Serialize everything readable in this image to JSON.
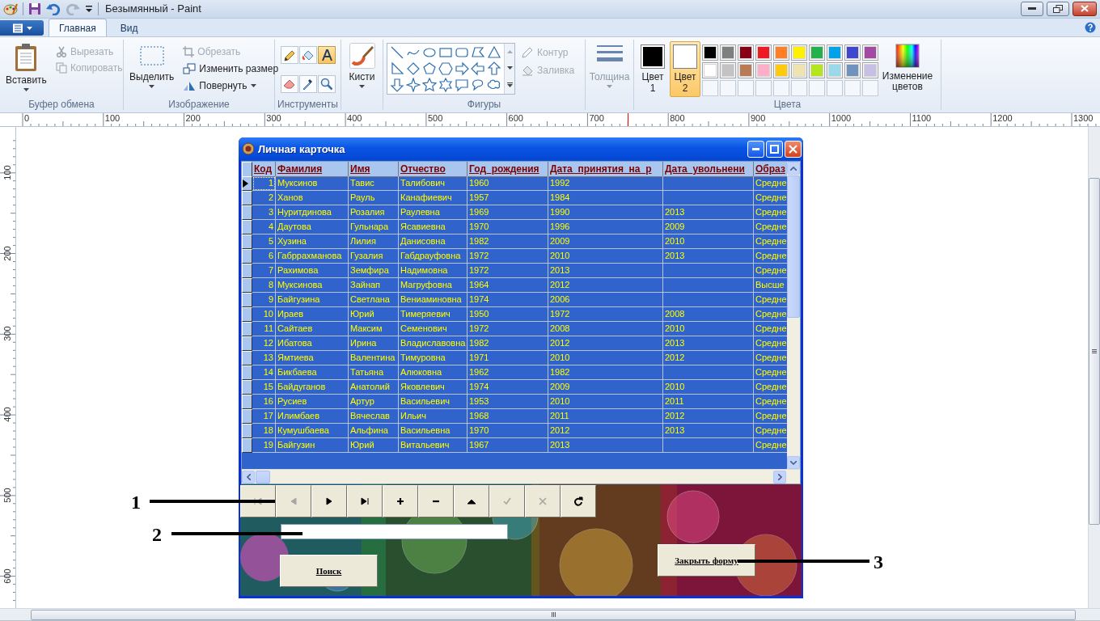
{
  "window": {
    "title": "Безымянный - Paint"
  },
  "ribbon_tabs": [
    {
      "label": "Главная",
      "selected": true
    },
    {
      "label": "Вид",
      "selected": false
    }
  ],
  "clipboard": {
    "label": "Буфер обмена",
    "paste": "Вставить",
    "cut": {
      "label": "Вырезать",
      "disabled": true
    },
    "copy": {
      "label": "Копировать",
      "disabled": true
    }
  },
  "image": {
    "label": "Изображение",
    "select": "Выделить",
    "crop": {
      "label": "Обрезать",
      "disabled": true
    },
    "resize": {
      "label": "Изменить размер",
      "disabled": false
    },
    "rotate": {
      "label": "Повернуть",
      "disabled": false
    }
  },
  "tools": {
    "label": "Инструменты",
    "items": [
      {
        "kind": "pencil",
        "selected": false
      },
      {
        "kind": "fill",
        "selected": false
      },
      {
        "kind": "text",
        "selected": true
      },
      {
        "kind": "eraser",
        "selected": false
      },
      {
        "kind": "picker",
        "selected": false
      },
      {
        "kind": "magnifier",
        "selected": false
      }
    ]
  },
  "brushes": {
    "label": "Кисти"
  },
  "shapes": {
    "label": "Фигуры",
    "outline": {
      "label": "Контур",
      "disabled": true
    },
    "fill": {
      "label": "Заливка",
      "disabled": true
    }
  },
  "size": {
    "label": "Толщина",
    "disabled": true
  },
  "colors": {
    "label": "Цвета",
    "color1": {
      "label": "Цвет 1",
      "color": "#000000",
      "selected": false
    },
    "color2": {
      "label": "Цвет 2",
      "color": "#ffffff",
      "selected": true
    },
    "edit": "Изменение цветов",
    "palette": [
      {
        "color": "#000000"
      },
      {
        "color": "#7f7f7f"
      },
      {
        "color": "#880015"
      },
      {
        "color": "#ed1c24"
      },
      {
        "color": "#ff7f27"
      },
      {
        "color": "#fff200"
      },
      {
        "color": "#22b14c"
      },
      {
        "color": "#00a2e8"
      },
      {
        "color": "#3f48cc"
      },
      {
        "color": "#a349a4"
      },
      {
        "color": "#ffffff"
      },
      {
        "color": "#c3c3c3"
      },
      {
        "color": "#b97a57"
      },
      {
        "color": "#ffaec9"
      },
      {
        "color": "#ffc90e"
      },
      {
        "color": "#efe4b0"
      },
      {
        "color": "#b5e61d"
      },
      {
        "color": "#99d9ea"
      },
      {
        "color": "#7092be"
      },
      {
        "color": "#c8bfe7"
      }
    ]
  },
  "ruler": {
    "horizontal": [
      "0",
      "100",
      "200",
      "300",
      "400",
      "500",
      "600",
      "700",
      "800",
      "900",
      "1000",
      "1100",
      "1200",
      "1300"
    ],
    "vertical": [
      "100",
      "200",
      "300",
      "400",
      "500",
      "600"
    ]
  },
  "form": {
    "title": "Личная карточка",
    "columns": [
      "Код",
      "Фамилия",
      "Имя",
      "Отчество",
      "Год_рождения",
      "Дата_принятия_на_р",
      "Дата_увольнени",
      "Образ"
    ],
    "rows": [
      {
        "cells": [
          "1",
          "Муксинов",
          "Тавис",
          "Талибович",
          "1960",
          "1992",
          "",
          "Средне"
        ],
        "selected": true
      },
      {
        "cells": [
          "2",
          "Ханов",
          "Рауль",
          "Канафиевич",
          "1957",
          "1984",
          "",
          "Средне"
        ],
        "selected": false
      },
      {
        "cells": [
          "3",
          "Нуритдинова",
          "Розалия",
          "Раулевна",
          "1969",
          "1990",
          "2013",
          "Средне"
        ],
        "selected": false
      },
      {
        "cells": [
          "4",
          "Даутова",
          "Гульнара",
          "Ясавиевна",
          "1970",
          "1996",
          "2009",
          "Средне"
        ],
        "selected": false
      },
      {
        "cells": [
          "5",
          "Хузина",
          "Лилия",
          "Данисовна",
          "1982",
          "2009",
          "2010",
          "Средне"
        ],
        "selected": false
      },
      {
        "cells": [
          "6",
          "Габррахманова",
          "Гузалия",
          "Габдрауфовна",
          "1972",
          "2010",
          "2013",
          "Средне"
        ],
        "selected": false
      },
      {
        "cells": [
          "7",
          "Рахимова",
          "Земфира",
          "Надимовна",
          "1972",
          "2013",
          "",
          "Средне"
        ],
        "selected": false
      },
      {
        "cells": [
          "8",
          "Муксинова",
          "Зайнап",
          "Магруфовна",
          "1964",
          "2012",
          "",
          "Высше"
        ],
        "selected": false
      },
      {
        "cells": [
          "9",
          "Байгузина",
          "Светлана",
          "Вениаминовна",
          "1974",
          "2006",
          "",
          "Средне"
        ],
        "selected": false
      },
      {
        "cells": [
          "10",
          "Ираев",
          "Юрий",
          "Тимеряевич",
          "1950",
          "1972",
          "2008",
          "Средне"
        ],
        "selected": false
      },
      {
        "cells": [
          "11",
          "Сайтаев",
          "Максим",
          "Семенович",
          "1972",
          "2008",
          "2010",
          "Средне"
        ],
        "selected": false
      },
      {
        "cells": [
          "12",
          "Ибатова",
          "Ирина",
          "Владиславовна",
          "1982",
          "2012",
          "2013",
          "Средне"
        ],
        "selected": false
      },
      {
        "cells": [
          "13",
          "Ямтиева",
          "Валентина",
          "Тимуровна",
          "1971",
          "2010",
          "2012",
          "Средне"
        ],
        "selected": false
      },
      {
        "cells": [
          "14",
          "Бикбаева",
          "Татьяна",
          "Алюковна",
          "1962",
          "1982",
          "",
          "Средне"
        ],
        "selected": false
      },
      {
        "cells": [
          "15",
          "Байдуганов",
          "Анатолий",
          "Яковлевич",
          "1974",
          "2009",
          "2010",
          "Средне"
        ],
        "selected": false
      },
      {
        "cells": [
          "16",
          "Русиев",
          "Артур",
          "Васильевич",
          "1953",
          "2010",
          "2011",
          "Средне"
        ],
        "selected": false
      },
      {
        "cells": [
          "17",
          "Илимбаев",
          "Вячеслав",
          "Ильич",
          "1968",
          "2011",
          "2012",
          "Средне"
        ],
        "selected": false
      },
      {
        "cells": [
          "18",
          "Кумушбаева",
          "Альфина",
          "Васильевна",
          "1970",
          "2012",
          "2013",
          "Средне"
        ],
        "selected": false
      },
      {
        "cells": [
          "19",
          "Байгузин",
          "Юрий",
          "Витальевич",
          "1967",
          "2013",
          "",
          "Средне"
        ],
        "selected": false
      }
    ],
    "navigator": [
      {
        "kind": "first",
        "disabled": true
      },
      {
        "kind": "prior",
        "disabled": true
      },
      {
        "kind": "next",
        "disabled": false
      },
      {
        "kind": "last",
        "disabled": false
      },
      {
        "kind": "insert",
        "disabled": false
      },
      {
        "kind": "delete",
        "disabled": false
      },
      {
        "kind": "edit",
        "disabled": false
      },
      {
        "kind": "post",
        "disabled": true
      },
      {
        "kind": "cancel",
        "disabled": true
      },
      {
        "kind": "refresh",
        "disabled": false
      }
    ],
    "search": {
      "label": "Поиск"
    },
    "close": {
      "label": "Закрыть форму"
    }
  },
  "callouts": [
    {
      "label": "1"
    },
    {
      "label": "2"
    },
    {
      "label": "3"
    }
  ]
}
